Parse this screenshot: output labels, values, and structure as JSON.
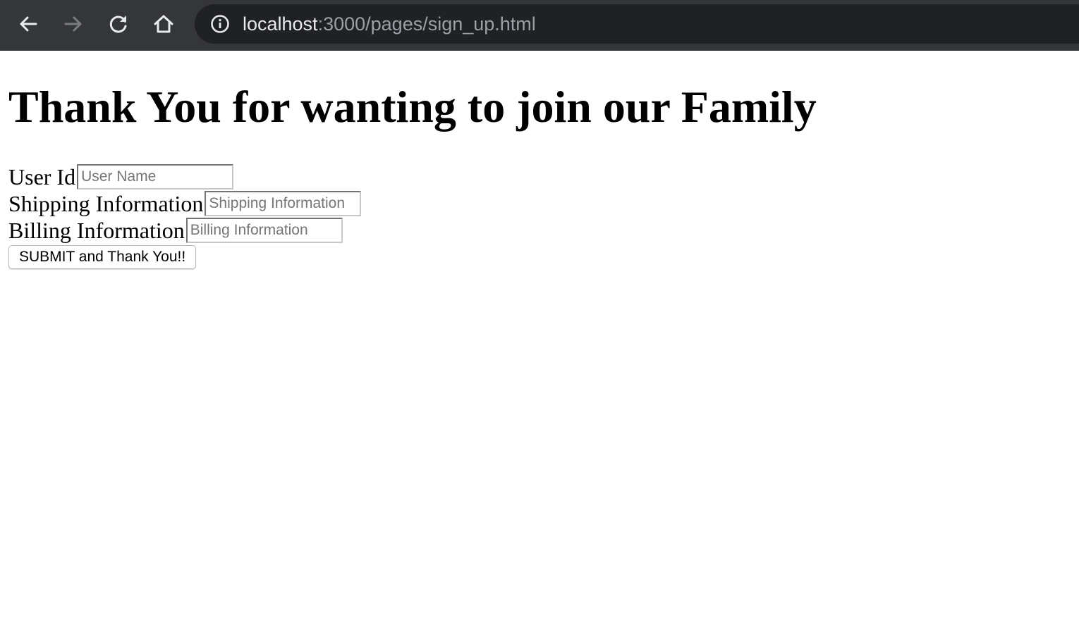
{
  "browser": {
    "url_host": "localhost",
    "url_path": ":3000/pages/sign_up.html",
    "toolbar_bg": "#35363a",
    "omnibox_bg": "#202124",
    "icons": {
      "back": "back-arrow-icon",
      "forward": "forward-arrow-icon",
      "reload": "reload-icon",
      "home": "home-icon",
      "info": "info-icon"
    }
  },
  "page": {
    "heading": "Thank You for wanting to join our Family",
    "form": {
      "user_id": {
        "label": "User Id",
        "placeholder": "User Name",
        "value": ""
      },
      "shipping": {
        "label": "Shipping Information",
        "placeholder": "Shipping Information",
        "value": ""
      },
      "billing": {
        "label": "Billing Information",
        "placeholder": "Billing Information",
        "value": ""
      },
      "submit_label": "SUBMIT and Thank You!!"
    }
  }
}
